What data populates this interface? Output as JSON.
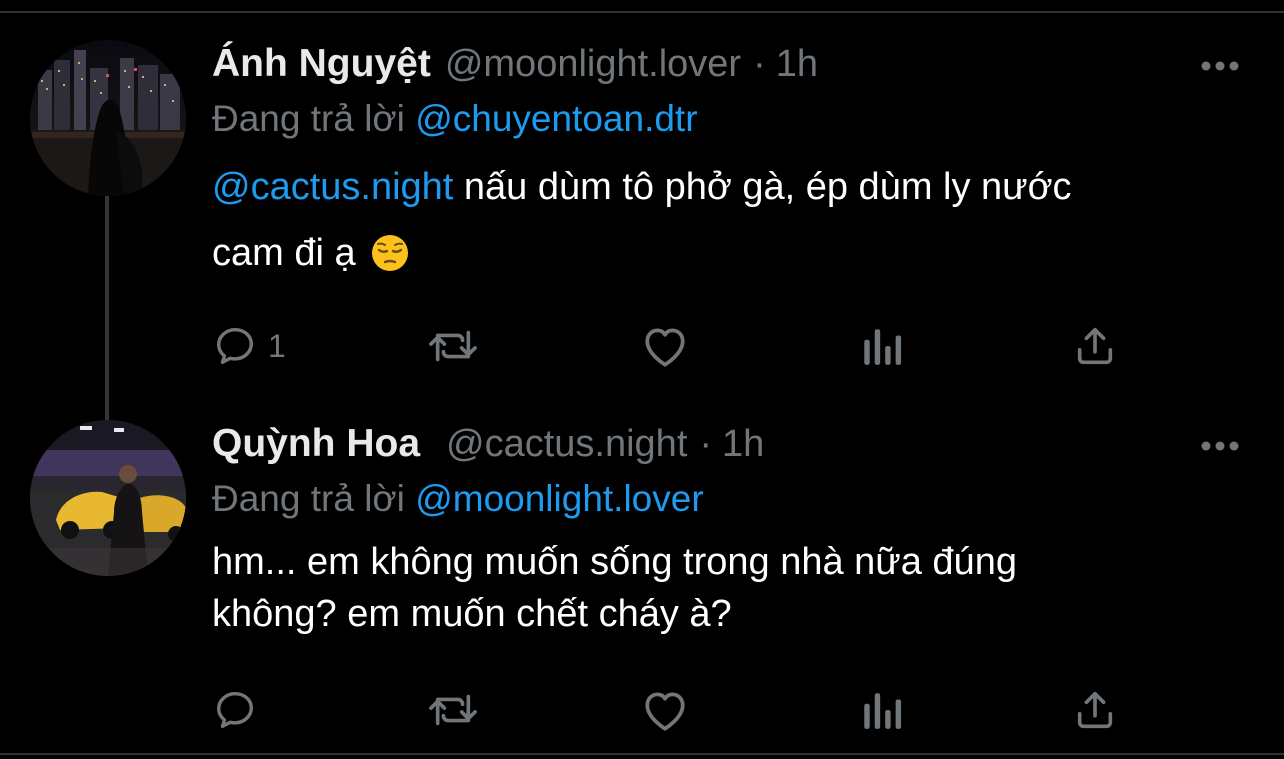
{
  "tweets": [
    {
      "display_name": "Ánh Nguyệt",
      "handle": "@moonlight.lover",
      "separator": "·",
      "time": "1h",
      "reply_prefix": "Đang trả lời",
      "reply_to": "@chuyentoan.dtr",
      "body_mention": "@cactus.night",
      "body_line1_text": " nấu dùm tô phở gà, ép dùm ly nước",
      "body_line2_text": "cam đi ạ",
      "emoji": "pensive-face-emoji",
      "reply_count": "1"
    },
    {
      "display_name": "Quỳnh Hoa",
      "handle": "@cactus.night",
      "separator": "·",
      "time": "1h",
      "reply_prefix": "Đang trả lời",
      "reply_to": "@moonlight.lover",
      "body_line1_text": "hm... em không muốn sống trong nhà nữa đúng",
      "body_line2_text": "không? em muốn chết cháy à?",
      "reply_count": ""
    }
  ],
  "icons": {
    "more": "more-horizontal-icon",
    "reply": "reply-icon",
    "retweet": "retweet-icon",
    "like": "heart-icon",
    "views": "analytics-icon",
    "share": "share-icon"
  },
  "colors": {
    "background": "#000000",
    "text_primary": "#e7e9ea",
    "text_secondary": "#71767b",
    "accent": "#1d9bf0",
    "divider": "#2f3336"
  }
}
